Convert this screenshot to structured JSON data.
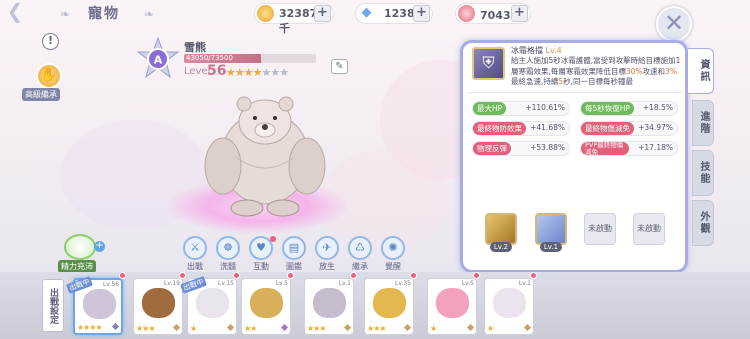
{
  "header": {
    "title": "寵物",
    "back_icon": "back-arrow-icon"
  },
  "currencies": [
    {
      "icon": "zeny-coin-icon",
      "value": "323873千",
      "color": "#f1b43a"
    },
    {
      "icon": "diamond-icon",
      "value": "1238",
      "color": "#6fa8ea"
    },
    {
      "icon": "boot-ticket-icon",
      "value": "7043千",
      "color": "#e2687d"
    }
  ],
  "left": {
    "advanced_label": "高級繼承",
    "energy_label": "精力充沛"
  },
  "pet": {
    "rank": "A",
    "name": "雪熊",
    "hp": "43050/73500",
    "hp_ratio": 0.586,
    "level_label": "Level",
    "level": "56",
    "stars_on": 4,
    "stars_total": 7
  },
  "actions": [
    {
      "label": "出戰",
      "icon": "swords-icon"
    },
    {
      "label": "洗髓",
      "icon": "wash-icon"
    },
    {
      "label": "互動",
      "icon": "heart-icon"
    },
    {
      "label": "圖鑑",
      "icon": "book-icon"
    },
    {
      "label": "放生",
      "icon": "release-icon"
    },
    {
      "label": "繼承",
      "icon": "inherit-icon"
    },
    {
      "label": "覺醒",
      "icon": "awaken-icon"
    }
  ],
  "skill": {
    "name": "冰霜格擋",
    "level": "Lv.4",
    "desc_parts": [
      "給主人施加5秒冰霜護體,當受到攻擊時給目標施加1層寒霜效果,每層寒霜效果降低目標",
      "30%",
      "攻速和",
      "3%",
      "最終急速,持續",
      "5",
      "秒,同一目標每秒鐘最"
    ]
  },
  "stats": [
    {
      "label": "最大HP",
      "value": "+110.61%",
      "kind": "green"
    },
    {
      "label": "每5秒恢復HP",
      "value": "+18.5%",
      "kind": "green"
    },
    {
      "label": "最終物防效果",
      "value": "+41.68%",
      "kind": "red"
    },
    {
      "label": "最終物傷減免",
      "value": "+34.97%",
      "kind": "red"
    },
    {
      "label": "物理反彈",
      "value": "+53.88%",
      "kind": "red"
    },
    {
      "label": "PVP最終物傷減免",
      "value": "+17.18%",
      "kind": "red"
    }
  ],
  "slots": [
    {
      "level": "Lv.2",
      "state": "filled",
      "icon": "gold-guard-icon"
    },
    {
      "level": "Lv.1",
      "state": "filled",
      "icon": "angel-icon"
    },
    {
      "label": "未啟動",
      "state": "empty"
    },
    {
      "label": "未啟動",
      "state": "empty"
    }
  ],
  "tabs": [
    {
      "label": "資訊",
      "active": true
    },
    {
      "label": "進階",
      "active": false
    },
    {
      "label": "技能",
      "active": false
    },
    {
      "label": "外觀",
      "active": false
    }
  ],
  "bottom": {
    "battle_setting": "出戰設定",
    "pets": [
      {
        "lv": "Lv.56",
        "stars": "★★★★",
        "tag": "出戰中",
        "color": "#cfc4d8",
        "selected": true,
        "gem": "#8a7ac8"
      },
      {
        "lv": "Lv.19",
        "stars": "★★★",
        "color": "#a06b3f",
        "gem": "#c9a060"
      },
      {
        "lv": "Lv.15",
        "stars": "★",
        "tag": "出戰中",
        "color": "#e9e3ec",
        "gem": "#c9a060"
      },
      {
        "lv": "Lv.5",
        "stars": "★★",
        "color": "#d8b05a",
        "gem": "#9a7ac8"
      },
      {
        "lv": "Lv.1",
        "stars": "★★★",
        "color": "#c5bccd",
        "gem": "#c9a060"
      },
      {
        "lv": "Lv.35",
        "stars": "★★★",
        "color": "#e3b84f",
        "gem": "#c9a060"
      },
      {
        "lv": "Lv.5",
        "stars": "★",
        "color": "#f4a2bb",
        "gem": "#c9a060"
      },
      {
        "lv": "Lv.1",
        "stars": "★",
        "color": "#ebe4ee",
        "gem": "#c9a060"
      }
    ]
  }
}
